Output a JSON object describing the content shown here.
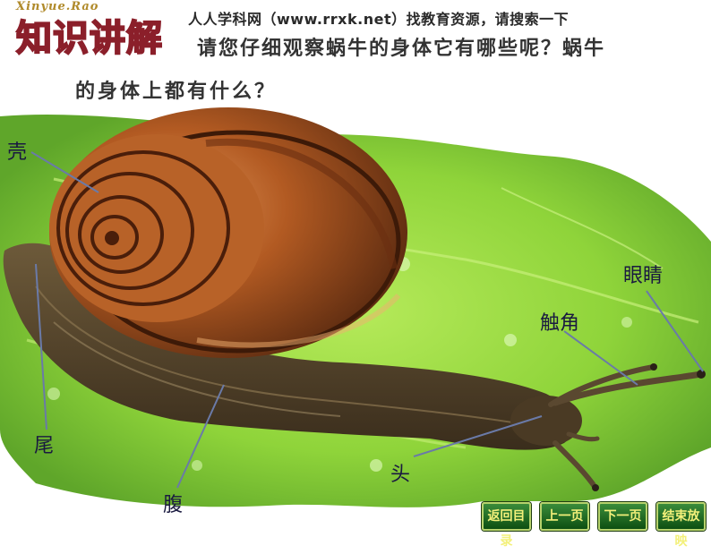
{
  "header": {
    "brand": "Xinyue.Rao",
    "title": "知识讲解",
    "banner": "人人学科网（www.rrxk.net）找教育资源，请搜索一下",
    "question_line1": "请您仔细观察蜗牛的身体它有哪些呢？蜗牛",
    "question_line2": "的身体上都有什么？"
  },
  "labels": {
    "shell": "壳",
    "eyes": "眼睛",
    "tentacle": "触角",
    "tail": "尾",
    "head": "头",
    "belly": "腹"
  },
  "nav": {
    "back_to_toc": "返回目录",
    "prev": "上一页",
    "next": "下一页",
    "end": "结束放映"
  },
  "colors": {
    "title_outline": "#8b1f2a",
    "leaf_green": "#8fd43a",
    "shell_brown": "#a0521d",
    "nav_green": "#1f6b1f",
    "nav_text": "#f3f07a"
  }
}
